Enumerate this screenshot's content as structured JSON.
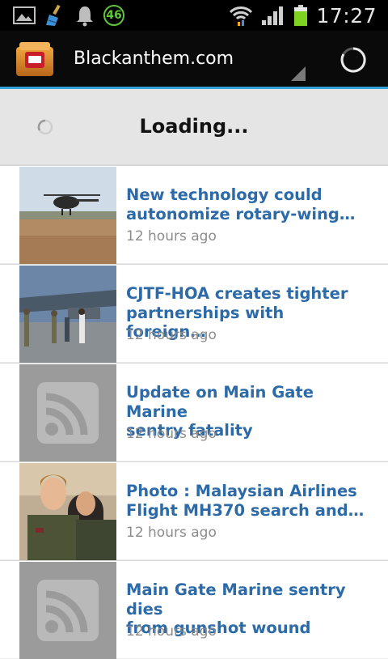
{
  "status_bar": {
    "notification_icons": [
      "gallery-icon",
      "cleaner-icon",
      "bell-icon"
    ],
    "badge_value": "46",
    "clock": "17:27",
    "battery_color": "#7ed321"
  },
  "app_bar": {
    "title": "Blackanthem.com",
    "accent_color": "#33a5dc"
  },
  "loading": {
    "text": "Loading..."
  },
  "articles": [
    {
      "title_line1": "New technology could",
      "title_line2": "autonomize rotary-wing…",
      "time": "12 hours ago",
      "thumb": "helicopter"
    },
    {
      "title_line1": "CJTF-HOA creates tighter",
      "title_line2": "partnerships with foreign…",
      "time": "12 hours ago",
      "thumb": "aircraft"
    },
    {
      "title_line1": "Update on Main Gate Marine",
      "title_line2": "sentry fatality",
      "time": "12 hours ago",
      "thumb": "rss-placeholder"
    },
    {
      "title_line1": "Photo : Malaysian Airlines",
      "title_line2": "Flight MH370 search and…",
      "time": "12 hours ago",
      "thumb": "people"
    },
    {
      "title_line1": "Main Gate Marine sentry dies",
      "title_line2": "from gunshot wound",
      "time": "12 hours ago",
      "thumb": "rss-placeholder"
    }
  ]
}
